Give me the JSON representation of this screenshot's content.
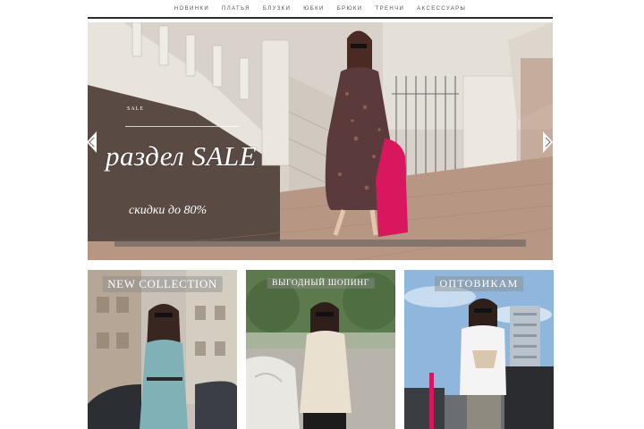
{
  "nav": {
    "items": [
      "НОВИНКИ",
      "ПЛАТЬЯ",
      "БЛУЗКИ",
      "ЮБКИ",
      "БРЮКИ",
      "ТРЕНЧИ",
      "АКСЕССУАРЫ"
    ]
  },
  "hero": {
    "small_label": "SALE",
    "title": "раздел SALE",
    "subtitle": "скидки до 80%"
  },
  "cards": [
    {
      "label": "NEW COLLECTION"
    },
    {
      "label": "ВЫГОДНЫЙ ШОПИНГ"
    },
    {
      "label": "ОПТОВИКАМ"
    }
  ],
  "colors": {
    "nav_rule": "#2b2b2b",
    "hero_text": "#ffffff",
    "dress_print": "#5a3a3a",
    "coat_accent": "#d8175e",
    "card1_dress": "#7fb1b6",
    "card2_trench": "#e9e0cf",
    "card3_sky": "#8fb6dc"
  },
  "icons": {
    "prev": "chevron-left-icon",
    "next": "chevron-right-icon"
  }
}
